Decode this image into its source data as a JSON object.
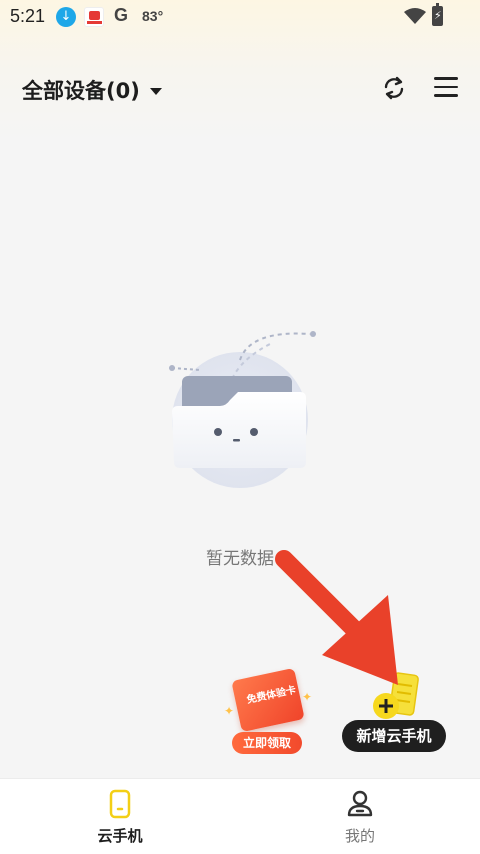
{
  "status_bar": {
    "time": "5:21",
    "google_letter": "G",
    "temperature": "83°",
    "battery_glyph": "⚡"
  },
  "header": {
    "title": "全部设备(0)"
  },
  "empty_state": {
    "message": "暂无数据"
  },
  "promo": {
    "trial_card_label": "免费体验卡",
    "trial_button": "立即领取",
    "add_button": "新增云手机"
  },
  "bottom_nav": {
    "items": [
      {
        "label": "云手机",
        "active": true,
        "icon": "phone-icon"
      },
      {
        "label": "我的",
        "active": false,
        "icon": "user-icon"
      }
    ]
  },
  "colors": {
    "accent": "#f6d81e",
    "brand_red": "#e9412a",
    "fab_dark": "#1f1f1f"
  }
}
